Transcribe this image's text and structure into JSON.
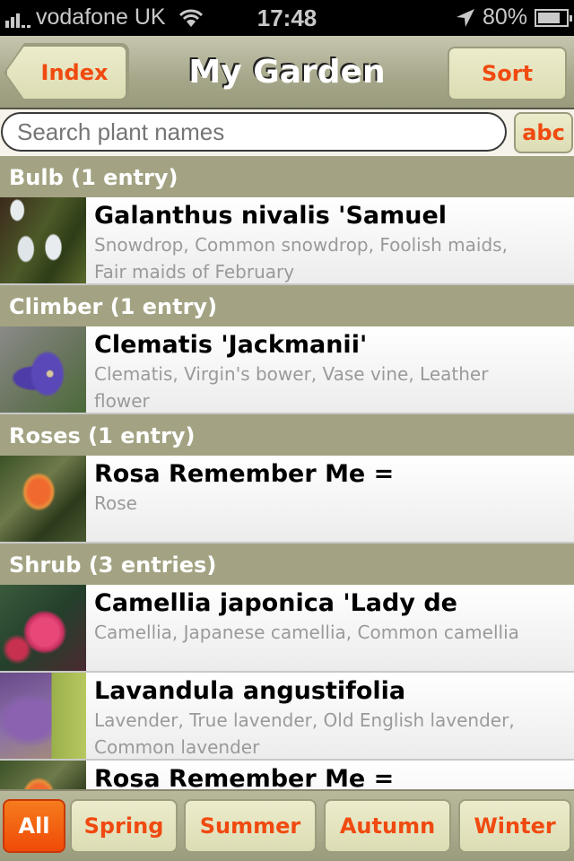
{
  "status_bar": {
    "carrier": "vodafone UK",
    "time": "17:48",
    "battery_percent": "80%",
    "battery_level": 0.8,
    "icons": [
      "signal-icon",
      "wifi-icon",
      "location-arrow-icon",
      "battery-icon"
    ]
  },
  "nav": {
    "title": "My Garden",
    "back_label": "Index",
    "sort_label": "Sort"
  },
  "search": {
    "placeholder": "Search plant names",
    "value": "",
    "abc_label": "abc"
  },
  "sections": [
    {
      "header": "Bulb (1 entry)",
      "items": [
        {
          "title": "Galanthus nivalis 'Samuel",
          "subtitle": "Snowdrop, Common snowdrop, Foolish maids, Fair maids of February",
          "thumb": "snowdrop-photo"
        }
      ]
    },
    {
      "header": "Climber (1 entry)",
      "items": [
        {
          "title": "Clematis 'Jackmanii'",
          "subtitle": "Clematis, Virgin's bower, Vase vine, Leather flower",
          "thumb": "clematis-photo"
        }
      ]
    },
    {
      "header": "Roses (1 entry)",
      "items": [
        {
          "title": "Rosa Remember Me =",
          "subtitle": "Rose",
          "thumb": "rose-photo"
        }
      ]
    },
    {
      "header": "Shrub (3 entries)",
      "items": [
        {
          "title": "Camellia japonica 'Lady de",
          "subtitle": "Camellia, Japanese camellia, Common camellia",
          "thumb": "camellia-photo"
        },
        {
          "title": "Lavandula angustifolia",
          "subtitle": "Lavender, True lavender, Old English lavender, Common lavender",
          "thumb": "lavender-photo"
        },
        {
          "title": "Rosa Remember Me =",
          "subtitle": "",
          "thumb": "rose-photo"
        }
      ]
    }
  ],
  "tabs": [
    {
      "label": "All",
      "active": true
    },
    {
      "label": "Spring",
      "active": false
    },
    {
      "label": "Summer",
      "active": false
    },
    {
      "label": "Autumn",
      "active": false
    },
    {
      "label": "Winter",
      "active": false
    }
  ],
  "colors": {
    "accent": "#f04a10",
    "section_header": "#a3a383",
    "active_tab": "#f05a10"
  }
}
